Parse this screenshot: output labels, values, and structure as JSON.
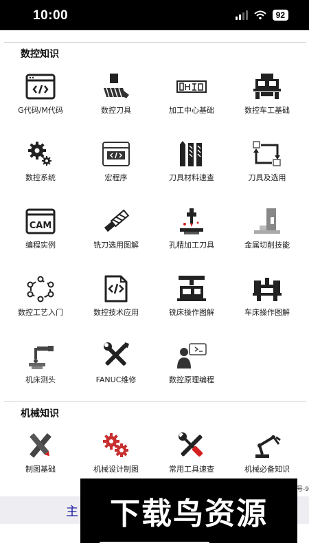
{
  "status_bar": {
    "time": "10:00",
    "battery": "92"
  },
  "sections": [
    {
      "title": "数控知识",
      "items": [
        {
          "label": "G代码/M代码",
          "icon": "code-window-icon"
        },
        {
          "label": "数控刀具",
          "icon": "cutting-tool-icon"
        },
        {
          "label": "加工中心基础",
          "icon": "machining-center-icon"
        },
        {
          "label": "数控车工基础",
          "icon": "cnc-lathe-icon"
        },
        {
          "label": "数控系统",
          "icon": "gears-icon"
        },
        {
          "label": "宏程序",
          "icon": "macro-window-icon"
        },
        {
          "label": "刀具材料速查",
          "icon": "tool-materials-icon"
        },
        {
          "label": "刀具及选用",
          "icon": "tool-selection-icon"
        },
        {
          "label": "编程实例",
          "icon": "cam-window-icon"
        },
        {
          "label": "铣刀选用图解",
          "icon": "end-mill-icon"
        },
        {
          "label": "孔精加工刀具",
          "icon": "drill-press-icon"
        },
        {
          "label": "金属切削技能",
          "icon": "metal-cutting-icon"
        },
        {
          "label": "数控工艺入门",
          "icon": "process-cycle-icon"
        },
        {
          "label": "数控技术应用",
          "icon": "code-document-icon"
        },
        {
          "label": "铣床操作图解",
          "icon": "milling-machine-icon"
        },
        {
          "label": "车床操作图解",
          "icon": "lathe-icon"
        },
        {
          "label": "机床测头",
          "icon": "probe-icon"
        },
        {
          "label": "FANUC维修",
          "icon": "wrench-screwdriver-icon"
        },
        {
          "label": "数控原理编程",
          "icon": "engineer-icon"
        }
      ]
    },
    {
      "title": "机械知识",
      "items": [
        {
          "label": "制图基础",
          "icon": "drafting-tools-icon"
        },
        {
          "label": "机械设计制图",
          "icon": "red-gears-icon"
        },
        {
          "label": "常用工具速查",
          "icon": "tools-cross-icon"
        },
        {
          "label": "机械必备知识",
          "icon": "robot-arm-icon"
        }
      ]
    }
  ],
  "tab_bar": {
    "label": "主"
  },
  "side_note": "号-9",
  "watermark": "下载鸟资源",
  "colors": {
    "accent_red": "#d42020",
    "tab_text": "#1a1aa0",
    "tab_bg": "#eeeef2"
  }
}
